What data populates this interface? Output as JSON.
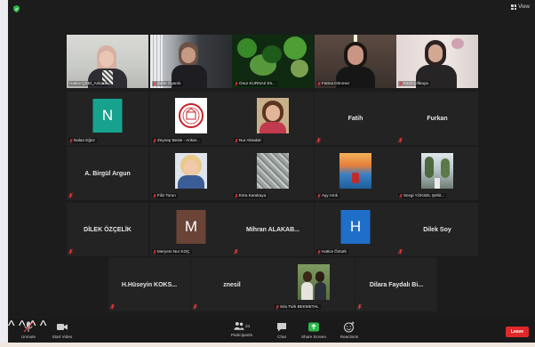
{
  "header": {
    "view_label": "View"
  },
  "colors": {
    "active_speaker": "#a8d845",
    "leave": "#e02828",
    "avatar_teal": "#17a28e",
    "avatar_brown": "#6a4437",
    "avatar_blue": "#1f6fc9",
    "mic_muted": "#e03b3b"
  },
  "participants": {
    "hatice": {
      "label": "Hatice ÇEBİ_Ankara",
      "muted": false,
      "active": true
    },
    "zafer": {
      "label": "Zafer Öyanık",
      "muted": true
    },
    "onur": {
      "label": "Onur KURNAZ Es...",
      "muted": true
    },
    "fatma": {
      "label": "Fatma Dönmez",
      "muted": true
    },
    "fazli": {
      "label": "Fazlı Çiftkaya",
      "muted": true
    },
    "nalan": {
      "label": "Nalan Eğez",
      "initial": "N",
      "muted": true
    },
    "zeynep": {
      "label": "Zeynep Beste - Ankar...",
      "muted": true
    },
    "nur": {
      "label": "Nur Aksakal",
      "muted": true
    },
    "fatih": {
      "name": "Fatih",
      "muted": true
    },
    "furkan": {
      "name": "Furkan",
      "muted": true
    },
    "birgul": {
      "name": "A. Birgül Argun",
      "muted": true
    },
    "filiz": {
      "label": "Filiz Torun",
      "muted": true
    },
    "esra": {
      "label": "Esra Karakaya",
      "muted": true
    },
    "ayy": {
      "label": "Ayy Artık",
      "muted": true
    },
    "sevgi": {
      "label": "Sevgi YÜKSEL Şehit...",
      "muted": true
    },
    "dilek_ozcelik": {
      "name": "DİLEK ÖZÇELİK",
      "muted": true
    },
    "meryem": {
      "label": "Meryem Nur KOÇ",
      "initial": "M",
      "muted": true
    },
    "mihran": {
      "name": "Mihran ALAKAB...",
      "muted": true
    },
    "hatice_ozturk": {
      "label": "Hatice Öztürk",
      "initial": "H",
      "muted": true
    },
    "dilek_soy": {
      "name": "Dilek Soy",
      "muted": true
    },
    "huseyin": {
      "name": "H.Hüseyin KOKS...",
      "muted": true
    },
    "znesil": {
      "name": "znesil",
      "muted": true
    },
    "sila": {
      "label": "Sıla Türk BEKMETAL",
      "muted": true
    },
    "dilara": {
      "name": "Dilara Faydalı Bi...",
      "muted": true
    }
  },
  "toolbar": {
    "unmute": "Unmute",
    "start_video": "Start Video",
    "participants": "Participants",
    "participants_count": "24",
    "chat": "Chat",
    "share_screen": "Share Screen",
    "reactions": "Reactions",
    "leave": "Leave"
  }
}
